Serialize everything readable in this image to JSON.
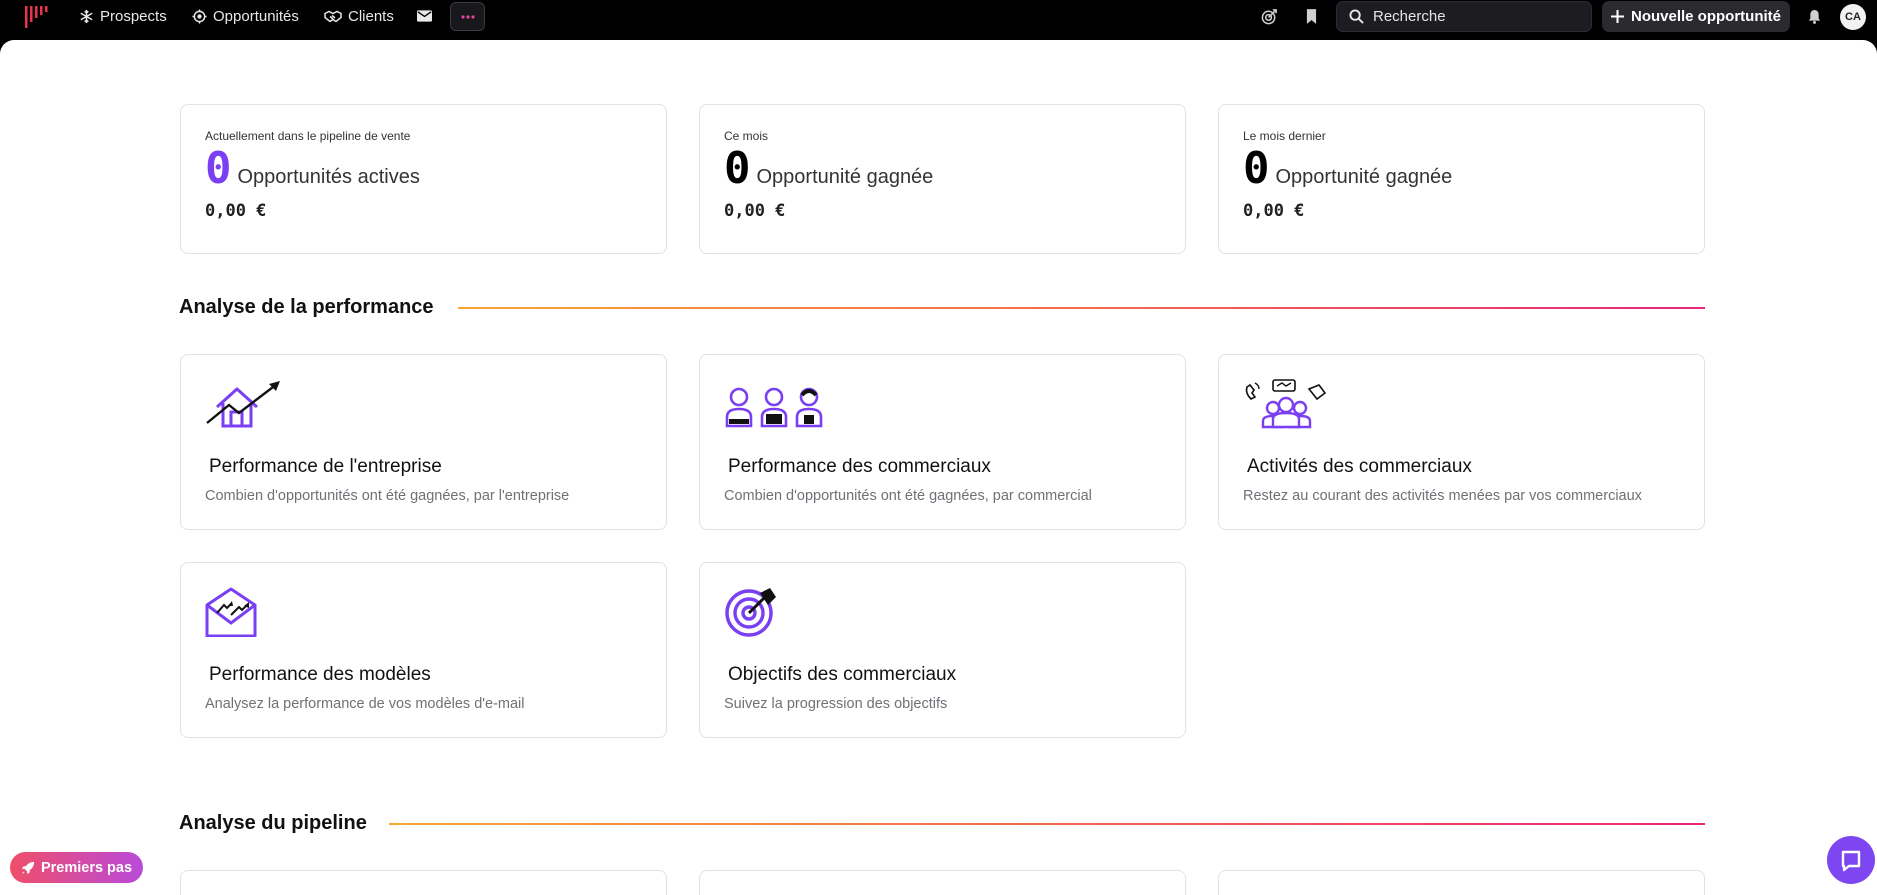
{
  "nav": {
    "items": [
      {
        "label": "Prospects",
        "icon": "snowflake-icon"
      },
      {
        "label": "Opportunités",
        "icon": "crosshair-icon"
      },
      {
        "label": "Clients",
        "icon": "handshake-icon"
      }
    ],
    "search_placeholder": "Recherche",
    "new_opportunity": "Nouvelle opportunité",
    "avatar_initials": "CA"
  },
  "stats": [
    {
      "label": "Actuellement dans le pipeline de vente",
      "count": "0",
      "text": "Opportunités actives",
      "amount": "0,00 €"
    },
    {
      "label": "Ce mois",
      "count": "0",
      "text": "Opportunité gagnée",
      "amount": "0,00 €"
    },
    {
      "label": "Le mois dernier",
      "count": "0",
      "text": "Opportunité gagnée",
      "amount": "0,00 €"
    }
  ],
  "sections": {
    "performance": "Analyse de la performance",
    "pipeline": "Analyse du pipeline"
  },
  "performance_cards": [
    {
      "title": "Performance de l'entreprise",
      "desc": "Combien d'opportunités ont été gagnées, par l'entreprise",
      "icon": "house-growth-icon"
    },
    {
      "title": "Performance des commerciaux",
      "desc": "Combien d'opportunités ont été gagnées, par commercial",
      "icon": "three-people-icon"
    },
    {
      "title": "Activités des commerciaux",
      "desc": "Restez au courant des activités menées par vos commerciaux",
      "icon": "team-activity-icon"
    },
    {
      "title": "Performance des modèles",
      "desc": "Analysez la performance de vos modèles d'e-mail",
      "icon": "envelope-chart-icon"
    },
    {
      "title": "Objectifs des commerciaux",
      "desc": "Suivez la progression des objectifs",
      "icon": "target-icon"
    }
  ],
  "premiers_pas": "Premiers pas",
  "colors": {
    "accent": "#7a3ff2",
    "gradient_start": "#f6a534",
    "gradient_end": "#e8267a"
  }
}
